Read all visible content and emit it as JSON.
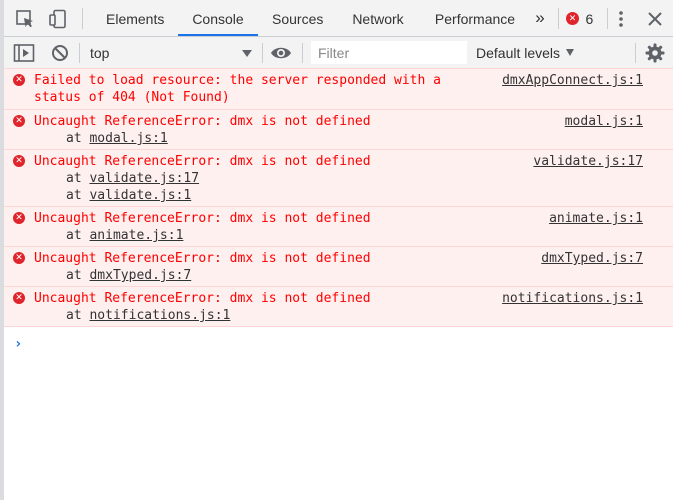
{
  "toolbar": {
    "tabs": [
      "Elements",
      "Console",
      "Sources",
      "Network",
      "Performance"
    ],
    "active_tab": "Console",
    "more_tabs": "»",
    "error_count": "6"
  },
  "filterbar": {
    "context": "top",
    "filter_placeholder": "Filter",
    "levels": "Default levels"
  },
  "messages": [
    {
      "text": "Failed to load resource: the server responded with a status of 404 (Not Found)",
      "source": "dmxAppConnect.js:1",
      "stack": []
    },
    {
      "text": "Uncaught ReferenceError: dmx is not defined",
      "source": "modal.js:1",
      "stack": [
        "modal.js:1"
      ]
    },
    {
      "text": "Uncaught ReferenceError: dmx is not defined",
      "source": "validate.js:17",
      "stack": [
        "validate.js:17",
        "validate.js:1"
      ]
    },
    {
      "text": "Uncaught ReferenceError: dmx is not defined",
      "source": "animate.js:1",
      "stack": [
        "animate.js:1"
      ]
    },
    {
      "text": "Uncaught ReferenceError: dmx is not defined",
      "source": "dmxTyped.js:7",
      "stack": [
        "dmxTyped.js:7"
      ]
    },
    {
      "text": "Uncaught ReferenceError: dmx is not defined",
      "source": "notifications.js:1",
      "stack": [
        "notifications.js:1"
      ]
    }
  ],
  "stack_prefix": "at",
  "prompt_symbol": "›",
  "colors": {
    "error_text": "#ff0000",
    "error_bg": "#fff0f0",
    "error_border": "#ffd6d6",
    "accent": "#1a73e8",
    "error_badge": "#e0242b"
  },
  "icons": [
    "inspect-element-icon",
    "device-toolbar-icon",
    "more-tabs-icon",
    "error-badge-icon",
    "kebab-menu-icon",
    "close-icon",
    "sidebar-toggle-icon",
    "clear-console-icon",
    "eye-icon",
    "settings-gear-icon",
    "error-circle-icon",
    "console-prompt-icon"
  ]
}
